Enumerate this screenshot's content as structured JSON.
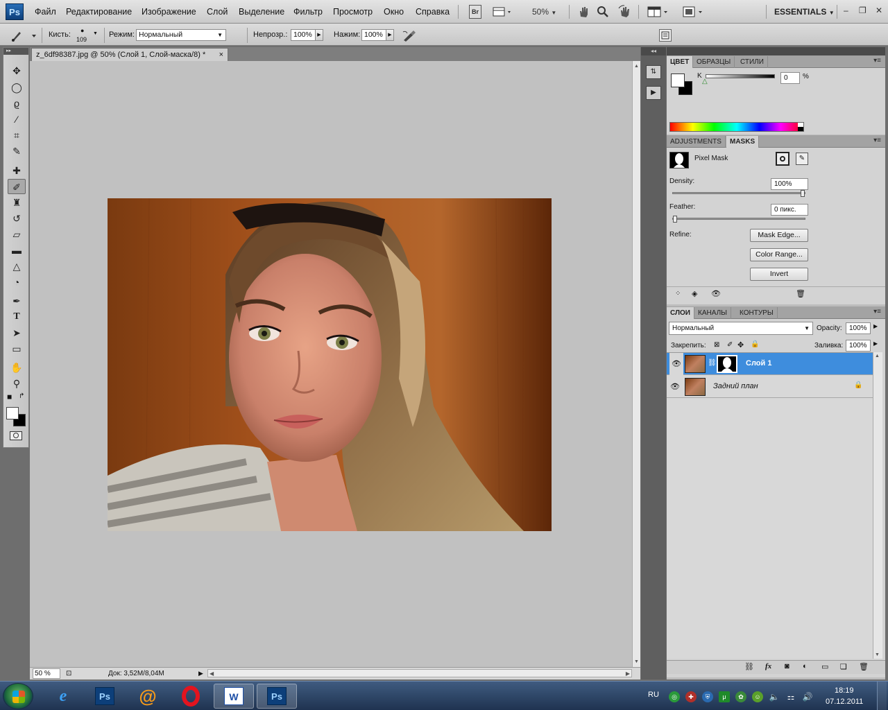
{
  "menubar": {
    "app_logo": "Ps",
    "items": [
      "Файл",
      "Редактирование",
      "Изображение",
      "Слой",
      "Выделение",
      "Фильтр",
      "Просмотр",
      "Окно",
      "Справка"
    ],
    "bridge_label": "Br",
    "zoom": "50%",
    "workspace": "ESSENTIALS"
  },
  "options": {
    "brush_label": "Кисть:",
    "brush_size": "109",
    "mode_label": "Режим:",
    "mode_value": "Нормальный",
    "opacity_label": "Непрозр.:",
    "opacity_value": "100%",
    "flow_label": "Нажим:",
    "flow_value": "100%"
  },
  "document": {
    "tab_title": "z_6df98387.jpg @ 50% (Слой 1, Слой-маска/8) *",
    "close_glyph": "×",
    "status_zoom": "50 %",
    "status_doc": "Док: 3,52M/8,04M"
  },
  "color_panel": {
    "tabs": [
      "ЦВЕТ",
      "ОБРАЗЦЫ",
      "СТИЛИ"
    ],
    "channel_label": "K",
    "channel_value": "0",
    "percent": "%"
  },
  "masks_panel": {
    "tabs": [
      "ADJUSTMENTS",
      "MASKS"
    ],
    "mask_type": "Pixel Mask",
    "density_label": "Density:",
    "density_value": "100%",
    "density_level": 1.0,
    "feather_label": "Feather:",
    "feather_value": "0 пикс.",
    "feather_level": 0.0,
    "refine_label": "Refine:",
    "buttons": [
      "Mask Edge...",
      "Color Range...",
      "Invert"
    ]
  },
  "layers_panel": {
    "tabs": [
      "СЛОИ",
      "КАНАЛЫ",
      "КОНТУРЫ"
    ],
    "blend_mode": "Нормальный",
    "opacity_label": "Opacity:",
    "opacity_value": "100%",
    "lock_label": "Закрепить:",
    "fill_label": "Заливка:",
    "fill_value": "100%",
    "layers": [
      {
        "name": "Слой 1",
        "selected": true,
        "has_mask": true
      },
      {
        "name": "Задний план",
        "selected": false,
        "locked": true
      }
    ]
  },
  "taskbar": {
    "apps": [
      "ie-icon",
      "ps-icon",
      "mail-agent-icon",
      "opera-icon",
      "word-icon",
      "photoshop-running-icon"
    ],
    "labels": {
      "ps": "Ps",
      "word": "W",
      "ps_running": "Ps"
    },
    "language": "RU",
    "time": "18:19",
    "date": "07.12.2011"
  },
  "colors": {
    "accent_selected_layer": "#3e8ddd",
    "panel_bg": "#d3d3d3",
    "canvas_bg": "#c1c1c1"
  }
}
